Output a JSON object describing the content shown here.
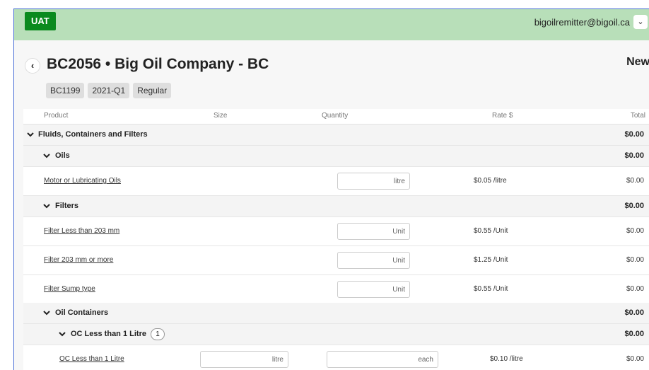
{
  "header": {
    "env_badge": "UAT",
    "user_email": "bigoilremitter@bigoil.ca",
    "user_dropdown": "⌄"
  },
  "page": {
    "back": "‹",
    "title": "BC2056 • Big Oil Company - BC",
    "status_label": "New",
    "tags": [
      "BC1199",
      "2021-Q1",
      "Regular"
    ]
  },
  "columns": {
    "product": "Product",
    "size": "Size",
    "quantity": "Quantity",
    "rate": "Rate $",
    "total": "Total"
  },
  "rows": [
    {
      "label": "Fluids, Containers and Filters",
      "total": "$0.00"
    },
    {
      "label": "Oils",
      "total": "$0.00"
    },
    {
      "label": "Motor or Lubricating Oils",
      "qty_unit": "litre",
      "rate": "$0.05 /litre",
      "total": "$0.00"
    },
    {
      "label": "Filters",
      "total": "$0.00"
    },
    {
      "label": "Filter Less than 203 mm",
      "qty_unit": "Unit",
      "rate": "$0.55 /Unit",
      "total": "$0.00"
    },
    {
      "label": "Filter 203 mm or more",
      "qty_unit": "Unit",
      "rate": "$1.25 /Unit",
      "total": "$0.00"
    },
    {
      "label": "Filter Sump type",
      "qty_unit": "Unit",
      "rate": "$0.55 /Unit",
      "total": "$0.00"
    },
    {
      "label": "Oil Containers",
      "total": "$0.00"
    },
    {
      "label": "OC Less than 1 Litre",
      "count": "1",
      "total": "$0.00"
    },
    {
      "label": "OC Less than 1 Litre",
      "size_unit": "litre",
      "qty_unit": "each",
      "rate": "$0.10 /litre",
      "total": "$0.00"
    }
  ]
}
